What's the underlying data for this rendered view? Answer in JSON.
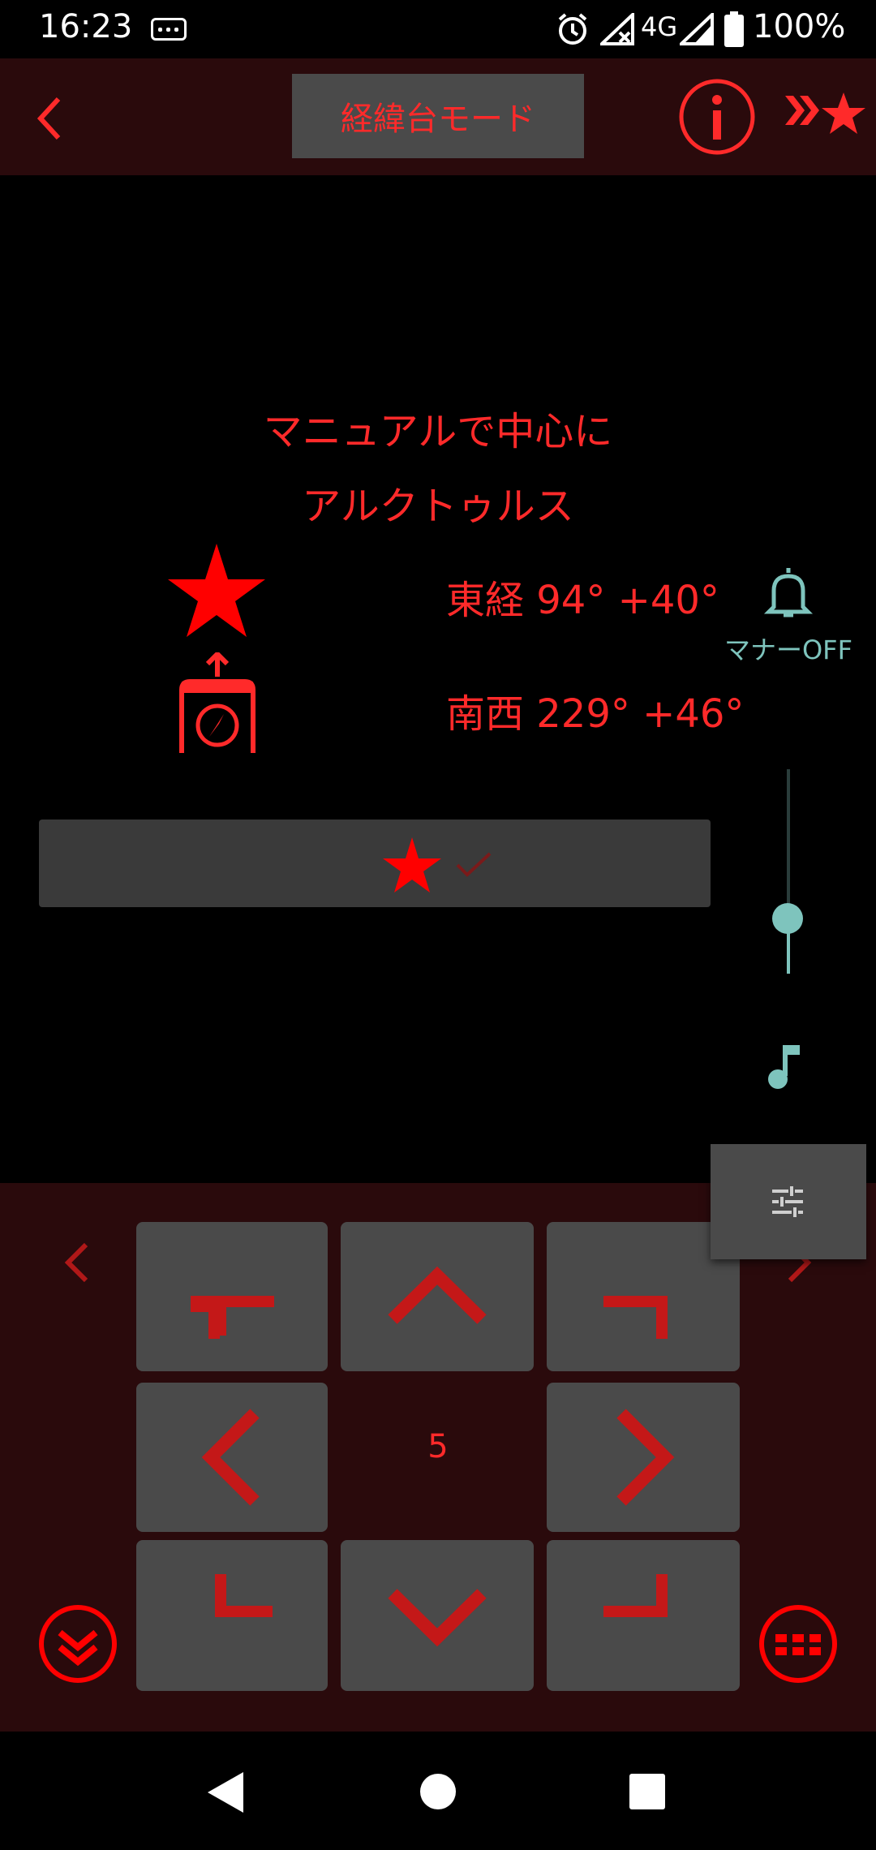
{
  "status_bar": {
    "time": "16:23",
    "network": "4G",
    "battery": "100%"
  },
  "header": {
    "title": "経緯台モード",
    "back_icon": "chevron-left-icon",
    "info_icon": "info-icon",
    "target_icon": "double-chevron-star-icon"
  },
  "guide": {
    "instruction": "マニュアルで中心に",
    "target": "アルクトゥルス",
    "coord_east": "東経 94° +40°",
    "coord_south_west": "南西 229° +46°"
  },
  "side": {
    "manner_label": "マナーOFF",
    "volume_level": 0.27
  },
  "pad": {
    "step": "5"
  },
  "colors": {
    "accent": "#ff2a2a",
    "panel": "#4a4a4a",
    "header_bg": "#2a0a0c",
    "teal": "#7ec4bd"
  }
}
